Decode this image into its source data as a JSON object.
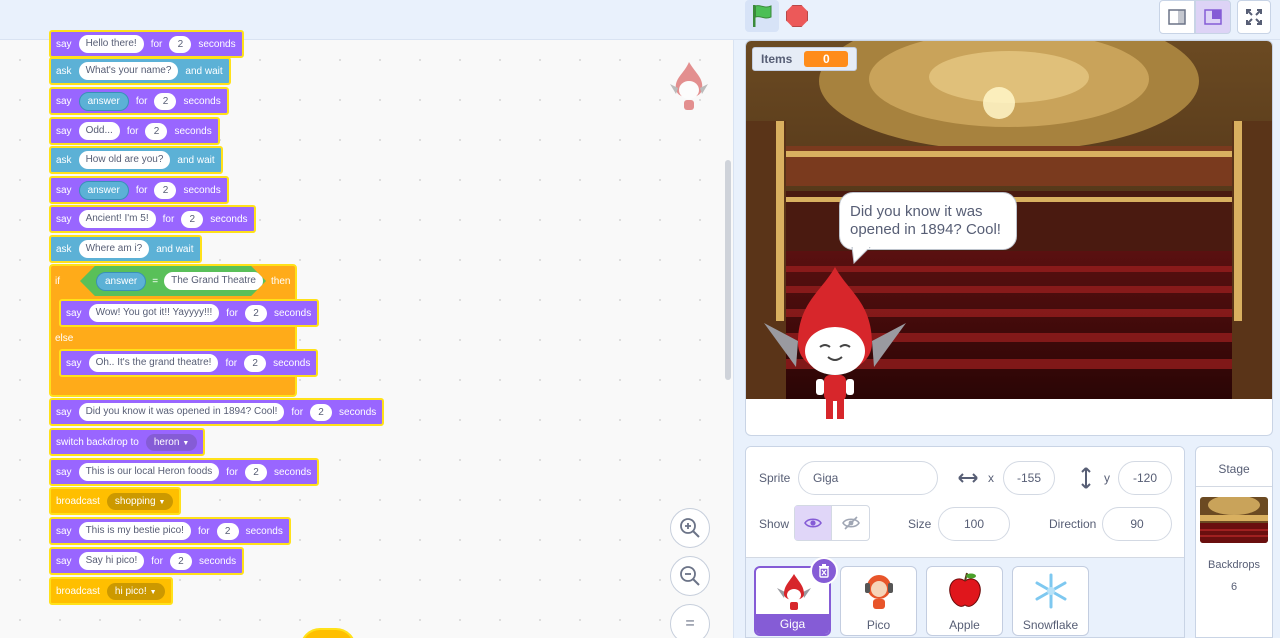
{
  "toolbar": {
    "green_flag": "green-flag",
    "stop": "stop"
  },
  "code": {
    "blocks": [
      {
        "kind": "say",
        "label": "say",
        "message": "Hello there!",
        "for": "for",
        "secs": "2",
        "unit": "seconds"
      },
      {
        "kind": "ask",
        "label": "ask",
        "question": "What's your name?",
        "tail": "and wait"
      },
      {
        "kind": "say",
        "label": "say",
        "reporter": "answer",
        "for": "for",
        "secs": "2",
        "unit": "seconds"
      },
      {
        "kind": "say",
        "label": "say",
        "message": "Odd...",
        "for": "for",
        "secs": "2",
        "unit": "seconds"
      },
      {
        "kind": "ask",
        "label": "ask",
        "question": "How old are you?",
        "tail": "and wait"
      },
      {
        "kind": "say",
        "label": "say",
        "reporter": "answer",
        "for": "for",
        "secs": "2",
        "unit": "seconds"
      },
      {
        "kind": "say",
        "label": "say",
        "message": "Ancient! I'm 5!",
        "for": "for",
        "secs": "2",
        "unit": "seconds"
      },
      {
        "kind": "ask",
        "label": "ask",
        "question": "Where am i?",
        "tail": "and wait"
      }
    ],
    "if_block": {
      "if_label": "if",
      "cond_reporter": "answer",
      "cond_op": "=",
      "cond_value": "The Grand Theatre",
      "then_label": "then",
      "else_label": "else",
      "then_say": {
        "label": "say",
        "message": "Wow! You got it!! Yayyyy!!!",
        "for": "for",
        "secs": "2",
        "unit": "seconds"
      },
      "else_say": {
        "label": "say",
        "message": "Oh.. It's the grand theatre!",
        "for": "for",
        "secs": "2",
        "unit": "seconds"
      }
    },
    "after": {
      "say1": {
        "label": "say",
        "message": "Did you know it was opened in 1894? Cool!",
        "for": "for",
        "secs": "2",
        "unit": "seconds"
      },
      "switch": {
        "label": "switch backdrop to",
        "value": "heron"
      },
      "say2": {
        "label": "say",
        "message": "This is our local Heron foods",
        "for": "for",
        "secs": "2",
        "unit": "seconds"
      },
      "broadcast1": {
        "label": "broadcast",
        "value": "shopping"
      },
      "say3": {
        "label": "say",
        "message": "This is my bestie pico!",
        "for": "for",
        "secs": "2",
        "unit": "seconds"
      },
      "say4": {
        "label": "say",
        "message": "Say hi pico!",
        "for": "for",
        "secs": "2",
        "unit": "seconds"
      },
      "broadcast2": {
        "label": "broadcast",
        "value": "hi pico!"
      }
    },
    "zoom": {
      "in": "+",
      "out": "−",
      "reset": "="
    }
  },
  "stage": {
    "monitor_label": "Items",
    "monitor_value": "0",
    "speech": "Did you know it was opened in 1894? Cool!"
  },
  "sprite_info": {
    "sprite_label": "Sprite",
    "sprite_name": "Giga",
    "x_label": "x",
    "x_value": "-155",
    "y_label": "y",
    "y_value": "-120",
    "show_label": "Show",
    "size_label": "Size",
    "size_value": "100",
    "direction_label": "Direction",
    "direction_value": "90"
  },
  "sprites": [
    "Giga",
    "Pico",
    "Apple",
    "Snowflake"
  ],
  "stage_pane": {
    "title": "Stage",
    "backdrops_label": "Backdrops",
    "backdrops_count": "6"
  },
  "colors": {
    "looks": "#9966ff",
    "sensing": "#5cb1d6",
    "events": "#ffbf00",
    "control": "#ffab19",
    "operators": "#59c059",
    "highlight": "#ffe11a",
    "accent": "#855cd6"
  }
}
